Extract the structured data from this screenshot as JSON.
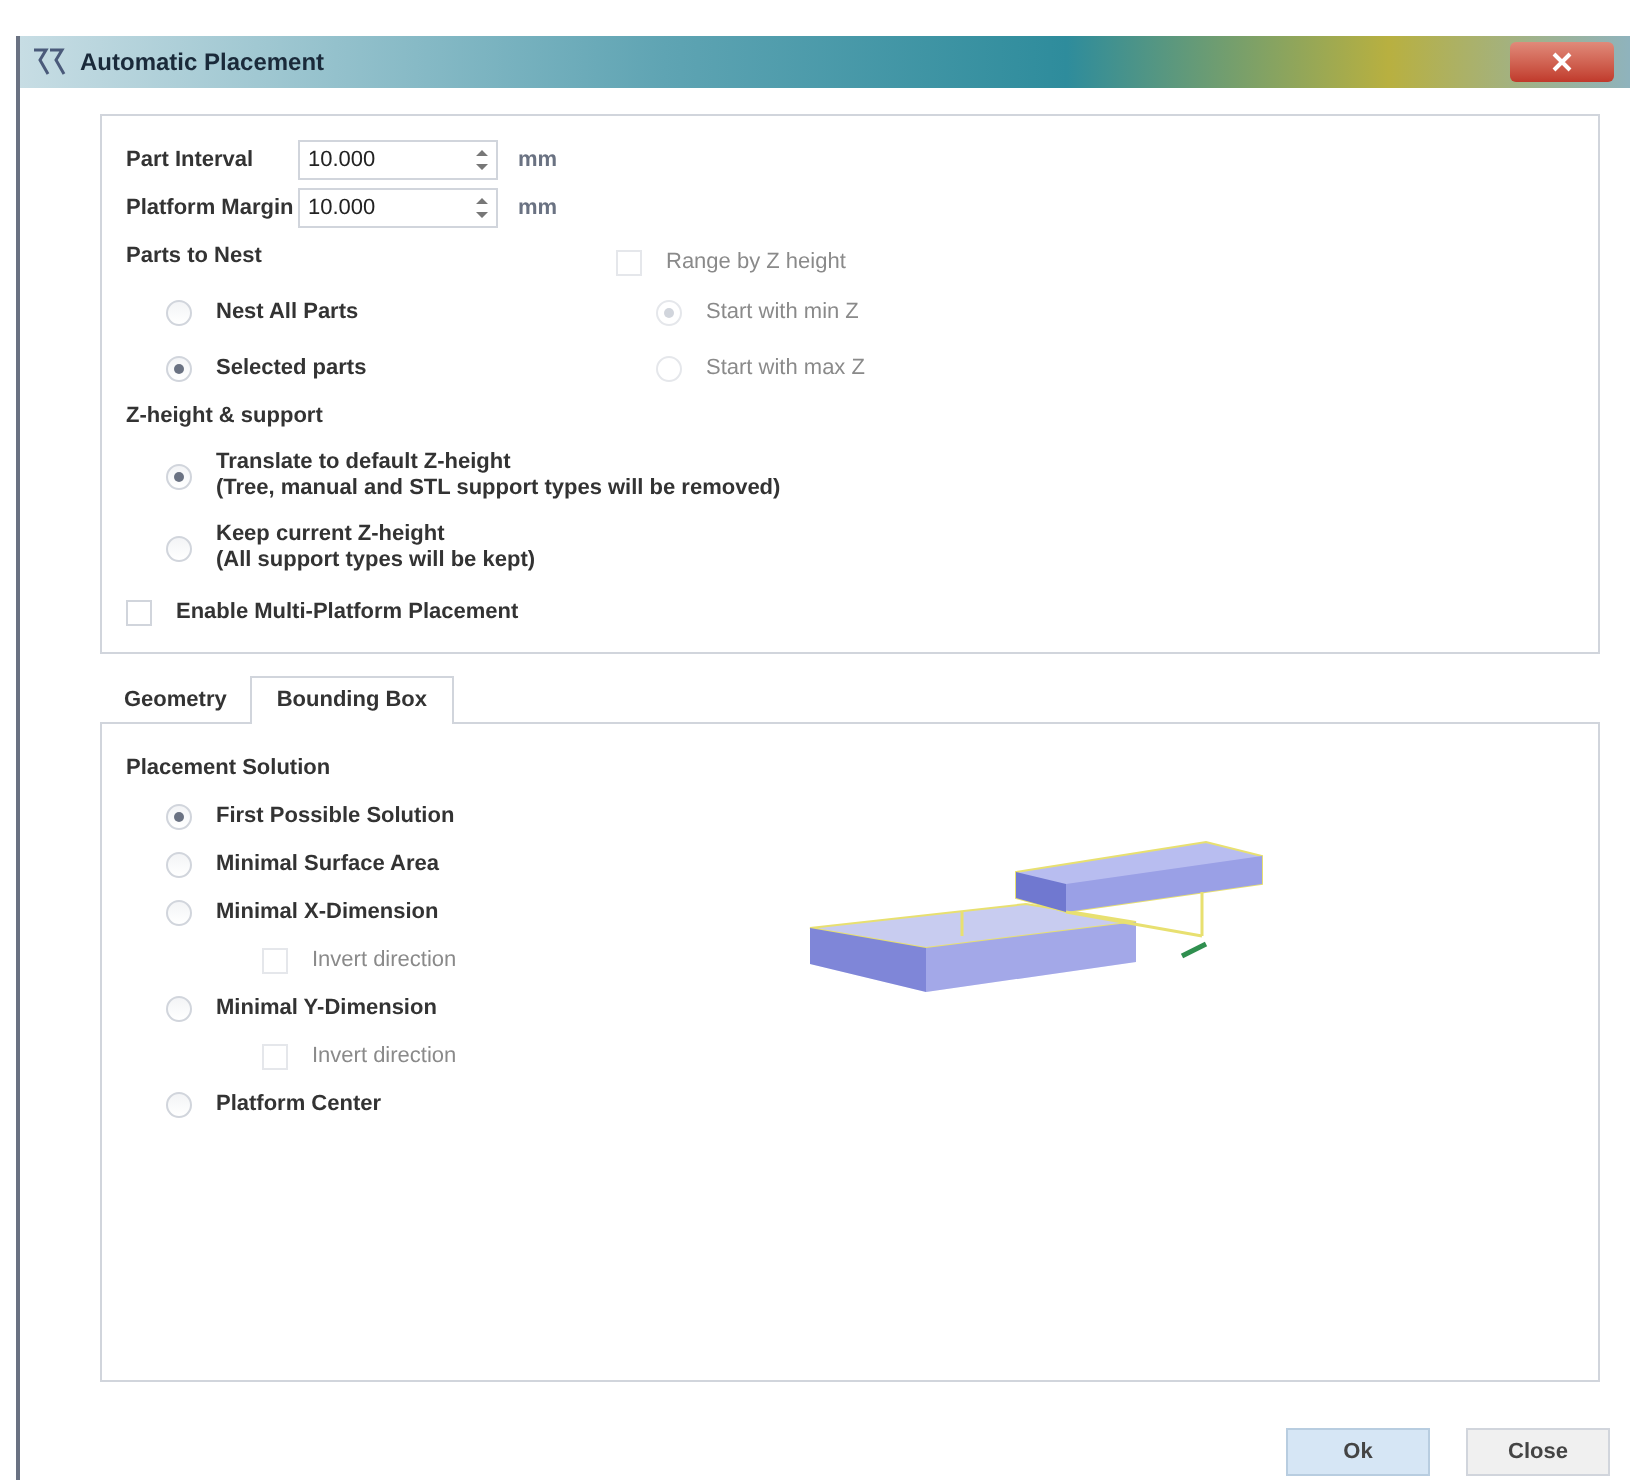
{
  "window": {
    "title": "Automatic Placement"
  },
  "fields": [
    {
      "label": "Part Interval",
      "value": "10.000",
      "unit": "mm"
    },
    {
      "label": "Platform Margin",
      "value": "10.000",
      "unit": "mm"
    }
  ],
  "parts_to_nest": {
    "title": "Parts to Nest",
    "options": [
      {
        "label": "Nest All Parts",
        "selected": false
      },
      {
        "label": "Selected parts",
        "selected": true
      }
    ]
  },
  "range_by_z": {
    "label": "Range by Z height",
    "checked": false,
    "disabled": true,
    "options": [
      {
        "label": "Start with min Z",
        "selected": true
      },
      {
        "label": "Start with max Z",
        "selected": false
      }
    ]
  },
  "z_height": {
    "title": "Z-height & support",
    "options": [
      {
        "label": "Translate to default Z-height",
        "note": "(Tree, manual and STL support types will be removed)",
        "selected": true
      },
      {
        "label": "Keep current Z-height",
        "note": "(All support types will be kept)",
        "selected": false
      }
    ]
  },
  "multi_platform": {
    "label": "Enable Multi-Platform Placement",
    "checked": false
  },
  "tabs": [
    {
      "label": "Geometry",
      "selected": false
    },
    {
      "label": "Bounding Box",
      "selected": true
    }
  ],
  "placement": {
    "title": "Placement Solution",
    "options": [
      {
        "label": "First Possible Solution",
        "selected": true
      },
      {
        "label": "Minimal Surface Area",
        "selected": false
      },
      {
        "label": "Minimal X-Dimension",
        "selected": false,
        "children": [
          {
            "label": "Invert direction",
            "checked": false,
            "disabled": true
          }
        ]
      },
      {
        "label": "Minimal Y-Dimension",
        "selected": false,
        "children": [
          {
            "label": "Invert direction",
            "checked": false,
            "disabled": true
          }
        ]
      },
      {
        "label": "Platform Center",
        "selected": false
      }
    ]
  },
  "buttons": [
    {
      "label": "Ok",
      "default": true
    },
    {
      "label": "Close",
      "default": false
    }
  ]
}
